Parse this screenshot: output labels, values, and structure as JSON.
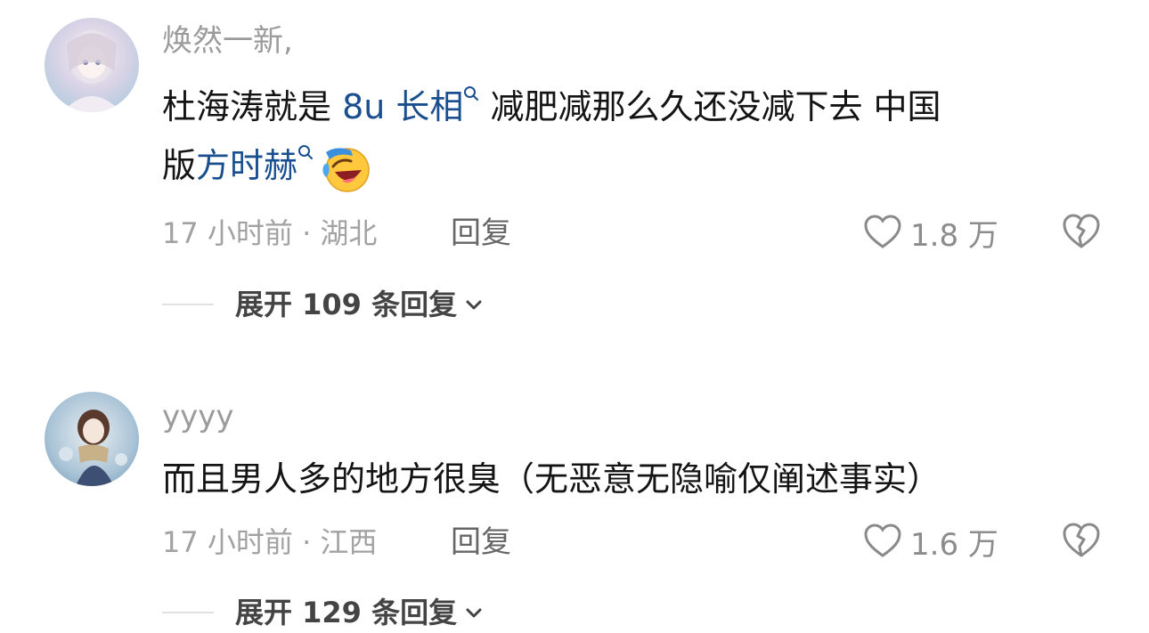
{
  "comments": [
    {
      "username": "焕然一新,",
      "text_line1_a": "杜海涛就是 ",
      "tag1": "8u 长相",
      "text_line1_b": "减肥减那么久还没减下去 中国",
      "text_line2_a": "版",
      "tag2": "方时赫",
      "emoji": "laughing-crying-emoji",
      "time_location": "17 小时前 · 湖北",
      "reply_label": "回复",
      "likes": "1.8 万",
      "expand_label": "展开 109 条回复"
    },
    {
      "username": "yyyy",
      "text": "而且男人多的地方很臭（无恶意无隐喻仅阐述事实）",
      "time_location": "17 小时前 · 江西",
      "reply_label": "回复",
      "likes": "1.6 万",
      "expand_label": "展开 129 条回复"
    }
  ],
  "colors": {
    "tag_link": "#1a4f8f",
    "meta_gray": "#a2a2a2",
    "text": "#141414"
  },
  "icons": [
    "heart-outline-icon",
    "broken-heart-icon",
    "chevron-down-icon",
    "search-icon"
  ]
}
